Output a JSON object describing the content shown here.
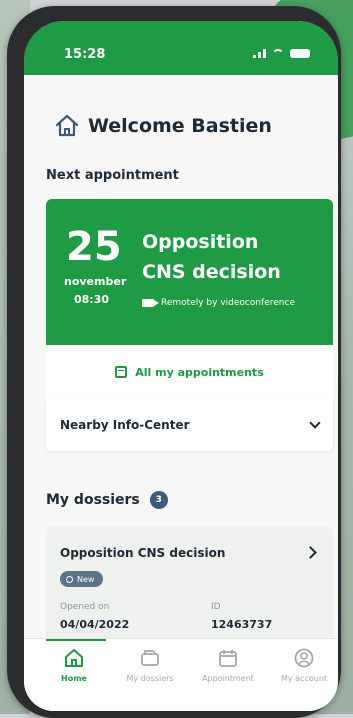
{
  "status_bar": {
    "time": "15:28"
  },
  "header": {
    "welcome": "Welcome Bastien"
  },
  "next_appointment": {
    "section_title": "Next appointment",
    "day": "25",
    "month": "november",
    "time": "08:30",
    "title_line1": "Opposition",
    "title_line2": "CNS decision",
    "mode": "Remotely by videoconference",
    "all_link": "All my appointments",
    "nearby": "Nearby Info-Center"
  },
  "dossiers": {
    "section_title": "My dossiers",
    "count": "3",
    "items": [
      {
        "title": "Opposition CNS decision",
        "status": "New",
        "opened_label": "Opened on",
        "opened_value": "04/04/2022",
        "id_label": "ID",
        "id_value": "12463737"
      }
    ]
  },
  "tabs": [
    {
      "label": "Home",
      "icon": "home-icon"
    },
    {
      "label": "My dossiers",
      "icon": "folders-icon"
    },
    {
      "label": "Appointment",
      "icon": "calendar-icon"
    },
    {
      "label": "My account",
      "icon": "account-icon"
    }
  ],
  "colors": {
    "brand_green": "#1f9a45",
    "badge_blue": "#3d5a7a",
    "text_dark": "#1e2a35"
  }
}
